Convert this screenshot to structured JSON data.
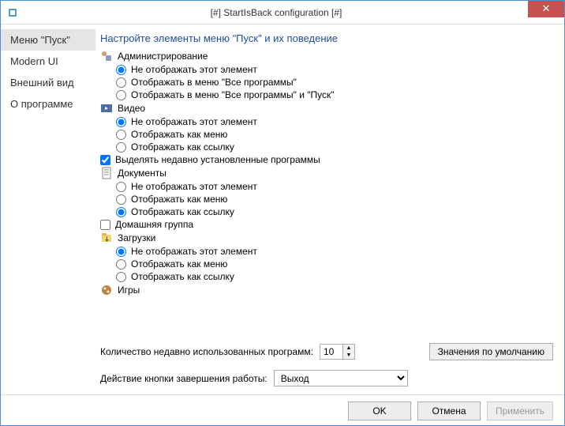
{
  "window": {
    "title": "[#] StartIsBack configuration [#]"
  },
  "sidebar": {
    "items": [
      {
        "label": "Меню \"Пуск\"",
        "active": true
      },
      {
        "label": "Modern UI",
        "active": false
      },
      {
        "label": "Внешний вид",
        "active": false
      },
      {
        "label": "О программе",
        "active": false
      }
    ]
  },
  "main": {
    "heading": "Настройте элементы меню \"Пуск\" и их поведение",
    "recent_label": "Количество недавно использованных программ:",
    "recent_value": "10",
    "defaults_button": "Значения по умолчанию",
    "shutdown_label": "Действие кнопки завершения работы:",
    "shutdown_value": "Выход"
  },
  "groups": [
    {
      "icon": "admin",
      "label": "Администрирование",
      "type": "radio",
      "options": [
        "Не отображать этот элемент",
        "Отображать в меню \"Все программы\"",
        "Отображать в меню \"Все программы\" и \"Пуск\""
      ],
      "selected": 0
    },
    {
      "icon": "video",
      "label": "Видео",
      "type": "radio",
      "options": [
        "Не отображать этот элемент",
        "Отображать как меню",
        "Отображать как ссылку"
      ],
      "selected": 0
    },
    {
      "icon": "check",
      "label": "Выделять недавно установленные программы",
      "type": "checkbox",
      "checked": true
    },
    {
      "icon": "docs",
      "label": "Документы",
      "type": "radio",
      "options": [
        "Не отображать этот элемент",
        "Отображать как меню",
        "Отображать как ссылку"
      ],
      "selected": 2
    },
    {
      "icon": "home",
      "label": "Домашняя группа",
      "type": "checkbox",
      "checked": false
    },
    {
      "icon": "downloads",
      "label": "Загрузки",
      "type": "radio",
      "options": [
        "Не отображать этот элемент",
        "Отображать как меню",
        "Отображать как ссылку"
      ],
      "selected": 0
    },
    {
      "icon": "games",
      "label": "Игры",
      "type": "radio",
      "options": [],
      "selected": -1
    }
  ],
  "footer": {
    "ok": "OK",
    "cancel": "Отмена",
    "apply": "Применить"
  }
}
